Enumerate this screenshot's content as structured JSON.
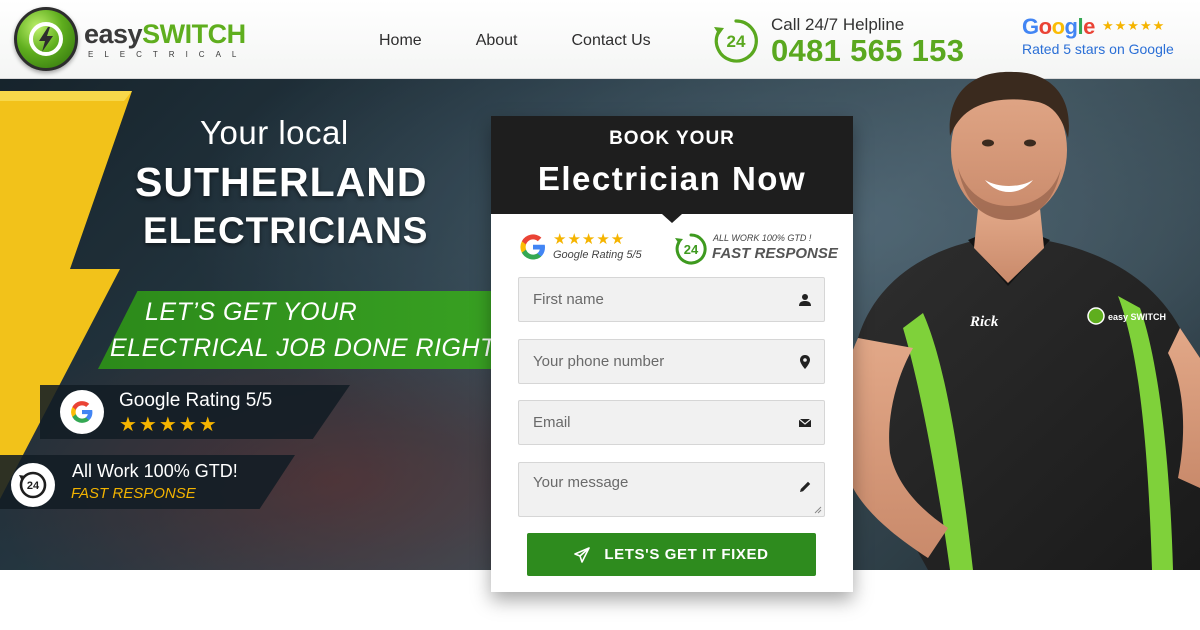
{
  "logo": {
    "word_easy": "easy",
    "word_switch": "SWITCH",
    "sub": "ELECTRICAL"
  },
  "nav": {
    "items": [
      {
        "label": "Home"
      },
      {
        "label": "About"
      },
      {
        "label": "Contact Us"
      }
    ]
  },
  "helpline": {
    "label": "Call 24/7 Helpline",
    "number": "0481 565 153",
    "icon_text": "24"
  },
  "google_header": {
    "letters": [
      "G",
      "o",
      "o",
      "g",
      "l",
      "e"
    ],
    "stars": "★★★★★",
    "rated_text": "Rated 5 stars on Google"
  },
  "hero": {
    "title_line1": "Your local",
    "title_line2": "SUTHERLAND",
    "title_line3": "ELECTRICIANS",
    "band_line1": "LET’S GET YOUR",
    "band_line2": "ELECTRICAL JOB DONE RIGHT",
    "rating_title": "Google Rating 5/5",
    "rating_stars": "★★★★★",
    "gtd_title": "All Work 100% GTD!",
    "gtd_sub": "FAST RESPONSE",
    "gtd_icon_text": "24"
  },
  "form": {
    "head_line1": "BOOK YOUR",
    "head_line2": "Electrician Now",
    "badge_google_stars": "★★★★★",
    "badge_google_text": "Google Rating 5/5",
    "badge_24_small": "ALL WORK 100% GTD !",
    "badge_24_big": "FAST RESPONSE",
    "badge_24_icon_text": "24",
    "fields": {
      "first_name": "First name",
      "phone": "Your phone number",
      "email": "Email",
      "message": "Your message"
    },
    "submit_label": "LETS'S GET IT FIXED"
  },
  "person": {
    "shirt_name": "Rick",
    "shirt_logo": "easy SWITCH"
  },
  "colors": {
    "brand_green": "#5aa81f",
    "button_green": "#2e8b1e",
    "star_gold": "#f5b400",
    "dark": "#1e1e1e"
  }
}
